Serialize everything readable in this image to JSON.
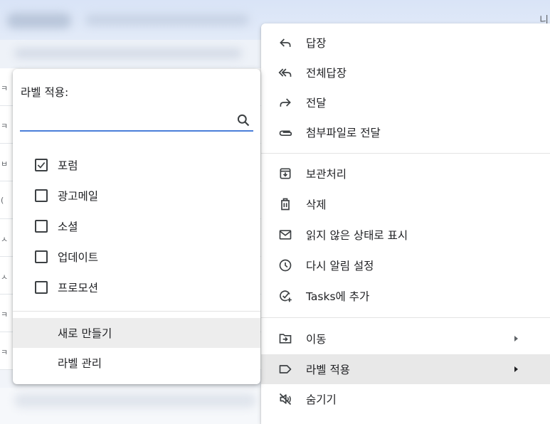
{
  "background": {
    "corner_char": "니",
    "row_marks_left": [
      "ㅋ",
      "ㅋ",
      "ㅂ",
      "(",
      "ㅅ",
      "ㅅ",
      "ㅋ",
      "ㅋ"
    ]
  },
  "context_menu": {
    "items": [
      {
        "label": "답장",
        "icon": "reply-icon"
      },
      {
        "label": "전체답장",
        "icon": "reply-all-icon"
      },
      {
        "label": "전달",
        "icon": "forward-icon"
      },
      {
        "label": "첨부파일로 전달",
        "icon": "attachment-icon"
      },
      {
        "label": "보관처리",
        "icon": "archive-icon"
      },
      {
        "label": "삭제",
        "icon": "trash-icon"
      },
      {
        "label": "읽지 않은 상태로 표시",
        "icon": "mail-icon"
      },
      {
        "label": "다시 알림 설정",
        "icon": "clock-icon"
      },
      {
        "label": "Tasks에 추가",
        "icon": "add-task-icon"
      },
      {
        "label": "이동",
        "icon": "move-to-icon"
      },
      {
        "label": "라벨 적용",
        "icon": "label-icon"
      },
      {
        "label": "숨기기",
        "icon": "mute-icon"
      }
    ]
  },
  "label_popup": {
    "title": "라벨 적용:",
    "search_value": "",
    "labels": [
      {
        "label": "포럼",
        "checked": true
      },
      {
        "label": "광고메일",
        "checked": false
      },
      {
        "label": "소셜",
        "checked": false
      },
      {
        "label": "업데이트",
        "checked": false
      },
      {
        "label": "프로모션",
        "checked": false
      }
    ],
    "actions": [
      {
        "label": "새로 만들기"
      },
      {
        "label": "라벨 관리"
      }
    ]
  },
  "colors": {
    "accent": "#4a7fd9",
    "highlight": "#e8e8e8",
    "text": "#202124",
    "icon": "#3c4043"
  }
}
